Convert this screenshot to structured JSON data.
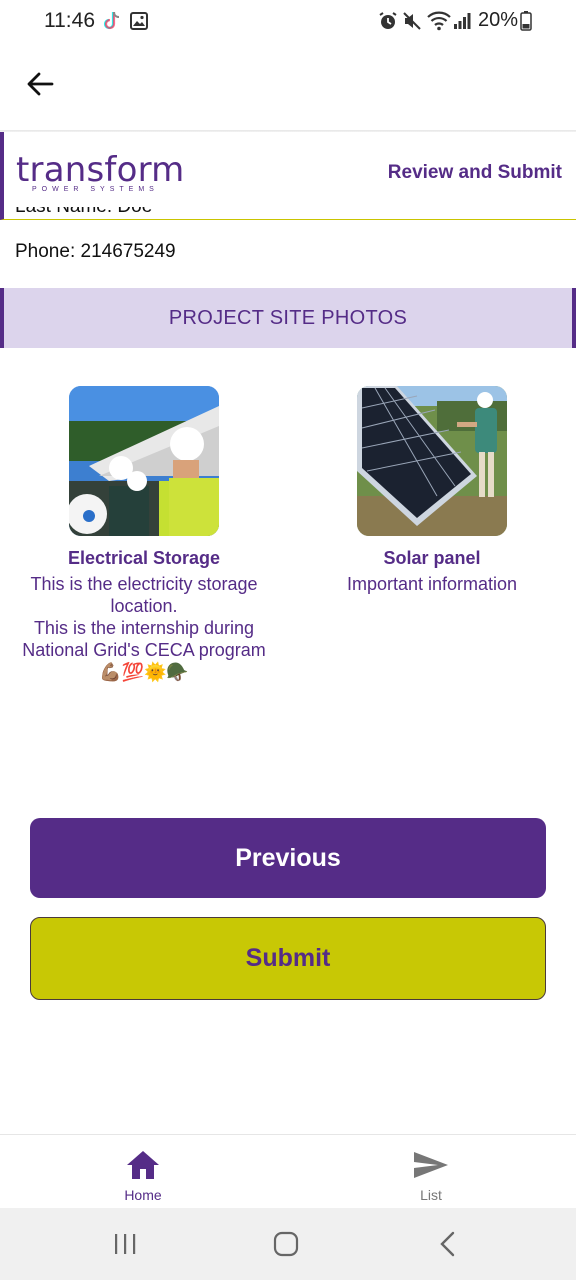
{
  "status_bar": {
    "time": "11:46",
    "battery": "20%",
    "icons": [
      "tiktok-icon",
      "gallery-icon",
      "alarm-icon",
      "mute-icon",
      "wifi-icon",
      "signal-icon",
      "battery-icon"
    ]
  },
  "app_bar": {
    "back_icon": "arrow-left-icon"
  },
  "header": {
    "logo_text": "transform",
    "logo_subtext": "POWER SYSTEMS",
    "title": "Review and Submit"
  },
  "details": {
    "last_name_partial": "Last Name: Doe",
    "phone": "Phone: 214675249"
  },
  "section": {
    "title": "PROJECT SITE PHOTOS"
  },
  "photos": [
    {
      "title": "Electrical Storage",
      "description": "This is the electricity storage location.\nThis is the internship during National Grid's CECA program\n💪🏽💯🌞🪖"
    },
    {
      "title": "Solar panel",
      "description": "Important information"
    }
  ],
  "buttons": {
    "previous": "Previous",
    "submit": "Submit"
  },
  "bottom_nav": {
    "home": "Home",
    "list": "List"
  },
  "colors": {
    "brand_purple": "#552c87",
    "brand_yellow": "#c8c805",
    "banner_bg": "#dcd4ec"
  }
}
